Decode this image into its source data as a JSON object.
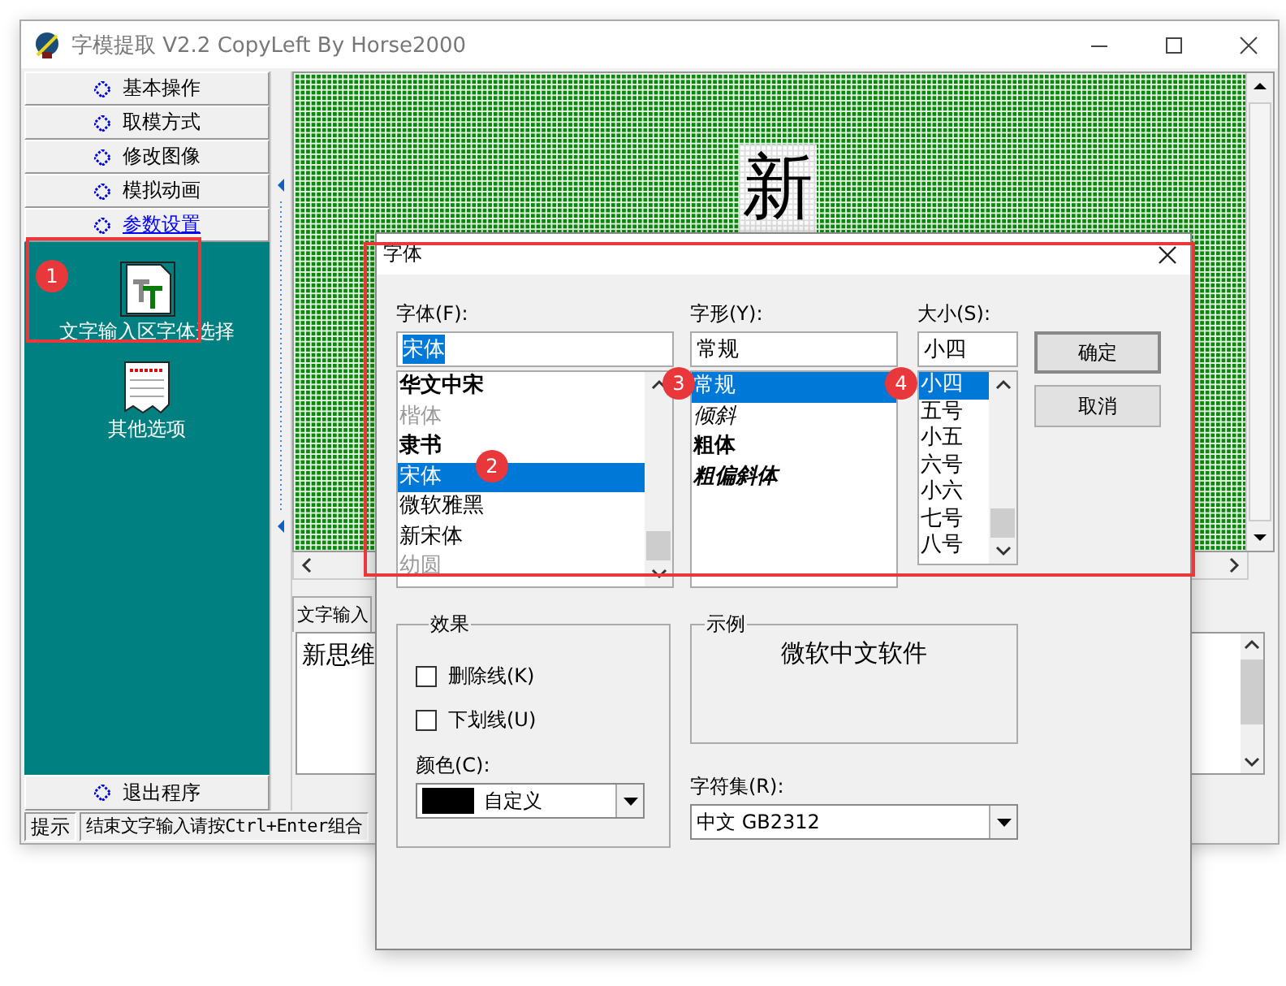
{
  "window": {
    "title": "字模提取 V2.2  CopyLeft By Horse2000"
  },
  "sidebar": {
    "items": [
      {
        "label": "基本操作",
        "selected": false
      },
      {
        "label": "取模方式",
        "selected": false
      },
      {
        "label": "修改图像",
        "selected": false
      },
      {
        "label": "模拟动画",
        "selected": false
      },
      {
        "label": "参数设置",
        "selected": true
      }
    ],
    "panel_items": [
      {
        "label": "文字输入区字体选择",
        "kind": "font"
      },
      {
        "label": "其他选项",
        "kind": "options"
      }
    ],
    "exit": {
      "label": "退出程序"
    }
  },
  "canvas": {
    "glyph": "新"
  },
  "input_panel": {
    "tab": "文字输入",
    "text": "新思维"
  },
  "status_bar": {
    "label": "提示",
    "message": "结束文字输入请按Ctrl+Enter组合"
  },
  "dialog": {
    "title": "字体",
    "font": {
      "label": "字体(F):",
      "value": "宋体",
      "options": [
        {
          "label": "华文中宋",
          "selected": false,
          "dimmed": false
        },
        {
          "label": "楷体",
          "selected": false,
          "dimmed": true
        },
        {
          "label": "隶书",
          "selected": false,
          "dimmed": false
        },
        {
          "label": "宋体",
          "selected": true,
          "dimmed": false
        },
        {
          "label": "微软雅黑",
          "selected": false,
          "dimmed": false
        },
        {
          "label": "新宋体",
          "selected": false,
          "dimmed": false
        },
        {
          "label": "幼圆",
          "selected": false,
          "dimmed": true
        }
      ]
    },
    "style": {
      "label": "字形(Y):",
      "value": "常规",
      "options": [
        {
          "label": "常规",
          "kind": "regular",
          "selected": true
        },
        {
          "label": "倾斜",
          "kind": "italic",
          "selected": false
        },
        {
          "label": "粗体",
          "kind": "bold",
          "selected": false
        },
        {
          "label": "粗偏斜体",
          "kind": "bold_italic",
          "selected": false
        }
      ]
    },
    "size": {
      "label": "大小(S):",
      "value": "小四",
      "options": [
        {
          "label": "小四",
          "selected": true
        },
        {
          "label": "五号",
          "selected": false
        },
        {
          "label": "小五",
          "selected": false
        },
        {
          "label": "六号",
          "selected": false
        },
        {
          "label": "小六",
          "selected": false
        },
        {
          "label": "七号",
          "selected": false
        },
        {
          "label": "八号",
          "selected": false
        }
      ]
    },
    "buttons": [
      "确定",
      "取消"
    ],
    "effects": {
      "title": "效果",
      "options": [
        {
          "label": "删除线(K)",
          "checked": false
        },
        {
          "label": "下划线(U)",
          "checked": false
        }
      ],
      "color_label": "颜色(C):",
      "color": {
        "label": "自定义",
        "color": "#000000"
      }
    },
    "sample": {
      "title": "示例",
      "text": "微软中文软件"
    },
    "charset": {
      "label": "字符集(R):",
      "value": "中文 GB2312"
    }
  },
  "annotations": [
    {
      "number": "1"
    },
    {
      "number": "2"
    },
    {
      "number": "3"
    },
    {
      "number": "4"
    }
  ]
}
